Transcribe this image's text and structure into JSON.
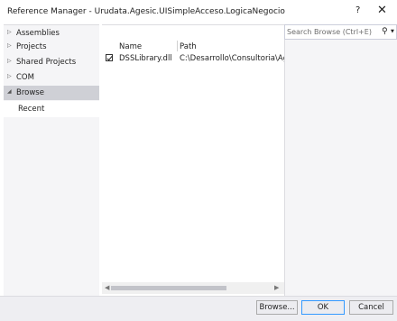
{
  "window": {
    "title": "Reference Manager - Urudata.Agesic.UISimpleAcceso.LogicaNegocio",
    "help_label": "?",
    "close_label": "✕"
  },
  "sidebar": {
    "items": [
      {
        "label": "Assemblies",
        "arrow": "▷"
      },
      {
        "label": "Projects",
        "arrow": "▷"
      },
      {
        "label": "Shared Projects",
        "arrow": "▷"
      },
      {
        "label": "COM",
        "arrow": "▷"
      },
      {
        "label": "Browse",
        "arrow": "◢"
      }
    ],
    "subitems": [
      {
        "label": "Recent"
      }
    ],
    "selected": "Browse"
  },
  "table": {
    "columns": [
      "Name",
      "Path"
    ],
    "rows": [
      {
        "checked": true,
        "name": "DSSLibrary.dll",
        "path": "C:\\Desarrollo\\Consultoria\\Agesic\\"
      }
    ]
  },
  "search": {
    "placeholder": "Search Browse (Ctrl+E)",
    "icon": "search-icon"
  },
  "footer": {
    "browse_label": "Browse...",
    "ok_label": "OK",
    "cancel_label": "Cancel"
  },
  "colors": {
    "sidebar_bg": "#f5f5f7",
    "selected_bg": "#cfd0d6",
    "ok_border": "#3399ff"
  }
}
